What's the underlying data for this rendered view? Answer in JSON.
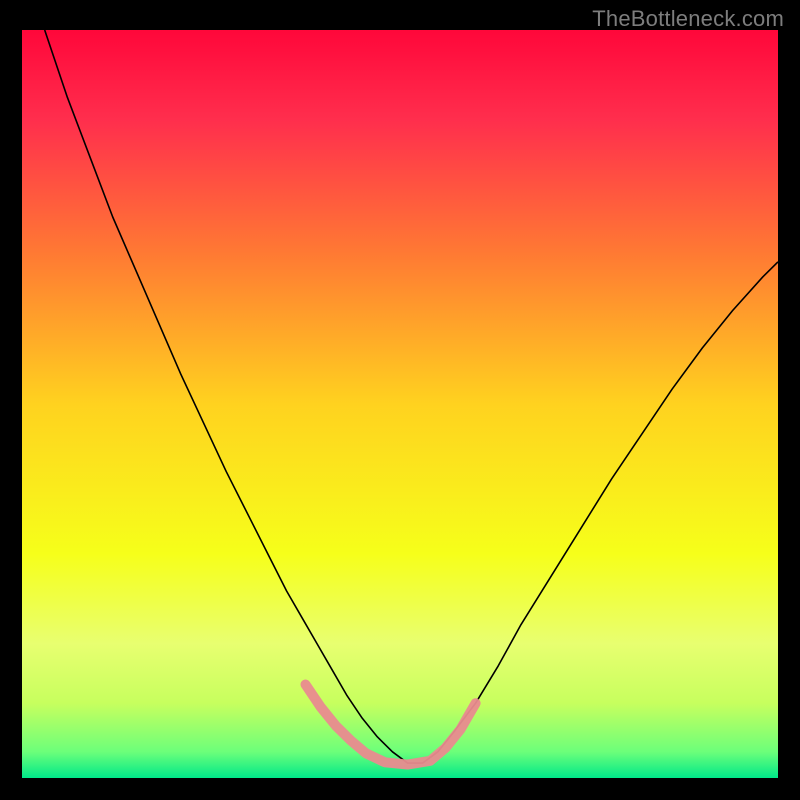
{
  "watermark": {
    "text": "TheBottleneck.com"
  },
  "chart_data": {
    "type": "line",
    "title": "",
    "xlabel": "",
    "ylabel": "",
    "xlim": [
      0,
      100
    ],
    "ylim": [
      0,
      100
    ],
    "grid": false,
    "background_gradient": {
      "stops": [
        {
          "offset": 0.0,
          "color": "#ff073a"
        },
        {
          "offset": 0.12,
          "color": "#ff2e4d"
        },
        {
          "offset": 0.3,
          "color": "#ff7a33"
        },
        {
          "offset": 0.5,
          "color": "#ffd21f"
        },
        {
          "offset": 0.7,
          "color": "#f6ff1a"
        },
        {
          "offset": 0.82,
          "color": "#e8ff70"
        },
        {
          "offset": 0.9,
          "color": "#c7ff5e"
        },
        {
          "offset": 0.965,
          "color": "#6cff7a"
        },
        {
          "offset": 1.0,
          "color": "#00e889"
        }
      ]
    },
    "series": [
      {
        "name": "bottleneck-curve",
        "color": "#000000",
        "stroke_width": 1.6,
        "x": [
          3,
          6,
          9,
          12,
          15,
          18,
          21,
          24,
          27,
          30,
          33,
          35,
          37,
          39,
          41,
          43,
          45,
          47,
          49,
          51,
          53,
          55,
          57,
          60,
          63,
          66,
          70,
          74,
          78,
          82,
          86,
          90,
          94,
          98,
          100
        ],
        "y": [
          100,
          91,
          83,
          75,
          68,
          61,
          54,
          47.5,
          41,
          35,
          29,
          25,
          21.5,
          18,
          14.5,
          11,
          8,
          5.5,
          3.5,
          2,
          2,
          3.5,
          6,
          10,
          15,
          20.5,
          27,
          33.5,
          40,
          46,
          52,
          57.5,
          62.5,
          67,
          69
        ]
      }
    ],
    "highlight_band": {
      "name": "optimal-zone-marker",
      "color": "#e98b8f",
      "stroke_width": 10,
      "linecap": "round",
      "x": [
        37.5,
        39.5,
        41.5,
        43.5,
        45.5,
        48,
        51,
        54,
        56,
        58,
        60
      ],
      "y": [
        12.5,
        9.5,
        7,
        5,
        3.3,
        2.1,
        1.8,
        2.3,
        4,
        6.5,
        10
      ]
    }
  }
}
